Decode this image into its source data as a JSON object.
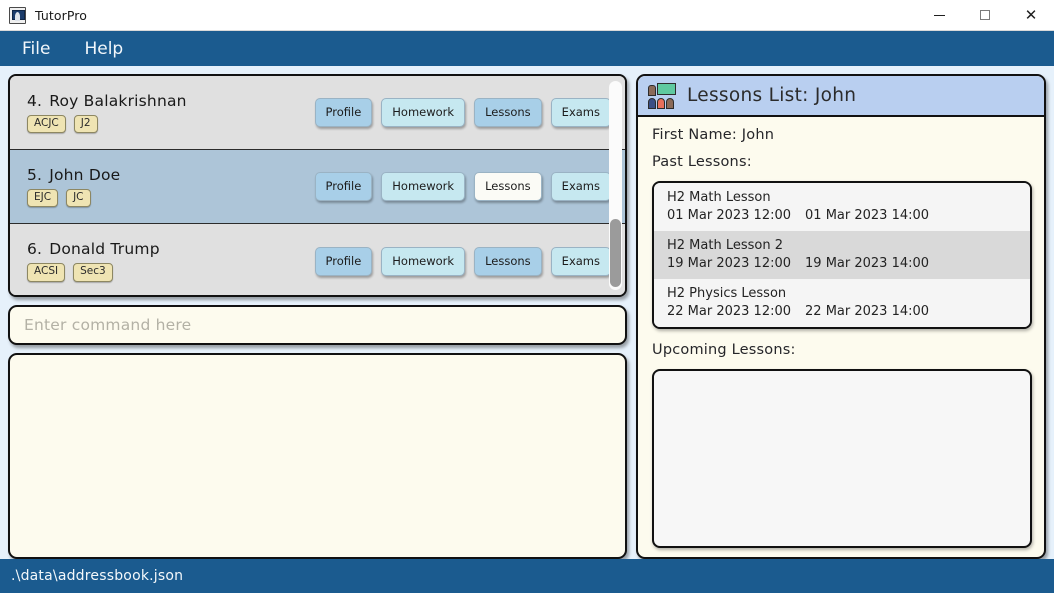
{
  "window": {
    "title": "TutorPro",
    "icon": "app-window-person-icon",
    "minimize_label": "—",
    "maximize_label": "",
    "close_label": "✕"
  },
  "menubar": {
    "items": [
      {
        "label": "File"
      },
      {
        "label": "Help"
      }
    ]
  },
  "person_list": {
    "rows": [
      {
        "index": "4.",
        "name": "Roy Balakrishnan",
        "selected": false,
        "tags": [
          "ACJC",
          "J2"
        ],
        "buttons": [
          {
            "label": "Profile",
            "style": "dark"
          },
          {
            "label": "Homework",
            "style": "light"
          },
          {
            "label": "Lessons",
            "style": "dark"
          },
          {
            "label": "Exams",
            "style": "light"
          }
        ]
      },
      {
        "index": "5.",
        "name": "John Doe",
        "selected": true,
        "tags": [
          "EJC",
          "JC"
        ],
        "buttons": [
          {
            "label": "Profile",
            "style": "dark"
          },
          {
            "label": "Homework",
            "style": "light"
          },
          {
            "label": "Lessons",
            "style": "active"
          },
          {
            "label": "Exams",
            "style": "light"
          }
        ]
      },
      {
        "index": "6.",
        "name": "Donald Trump",
        "selected": false,
        "tags": [
          "ACSI",
          "Sec3"
        ],
        "buttons": [
          {
            "label": "Profile",
            "style": "dark"
          },
          {
            "label": "Homework",
            "style": "light"
          },
          {
            "label": "Lessons",
            "style": "dark"
          },
          {
            "label": "Exams",
            "style": "light"
          }
        ]
      }
    ]
  },
  "command_box": {
    "value": "",
    "placeholder": "Enter command here"
  },
  "result_box": {
    "value": ""
  },
  "detail_panel": {
    "icon": "classroom-icon",
    "title": "Lessons List: John",
    "first_name_line": "First Name: John",
    "past_lessons_label": "Past Lessons:",
    "past_lessons": [
      {
        "title": "H2 Math Lesson",
        "start": "01 Mar 2023 12:00",
        "end": "01 Mar 2023 14:00"
      },
      {
        "title": "H2 Math Lesson 2",
        "start": "19 Mar 2023 12:00",
        "end": "19 Mar 2023 14:00"
      },
      {
        "title": "H2 Physics Lesson",
        "start": "22 Mar 2023 12:00",
        "end": "22 Mar 2023 14:00"
      }
    ],
    "upcoming_lessons_label": "Upcoming Lessons:",
    "upcoming_lessons": []
  },
  "statusbar": {
    "path": ".\\data\\addressbook.json"
  },
  "colors": {
    "chrome_blue": "#1b5b8f",
    "app_background": "#e6f1fb",
    "panel_cream": "#fdfbee",
    "selected_row": "#adc5d8",
    "unselected_row": "#e0e0e0",
    "tag_yellow": "#efe4b3",
    "button_blue": "#a8cfe8",
    "button_light_blue": "#c6e8f0",
    "detail_header_blue": "#b9cff0"
  }
}
